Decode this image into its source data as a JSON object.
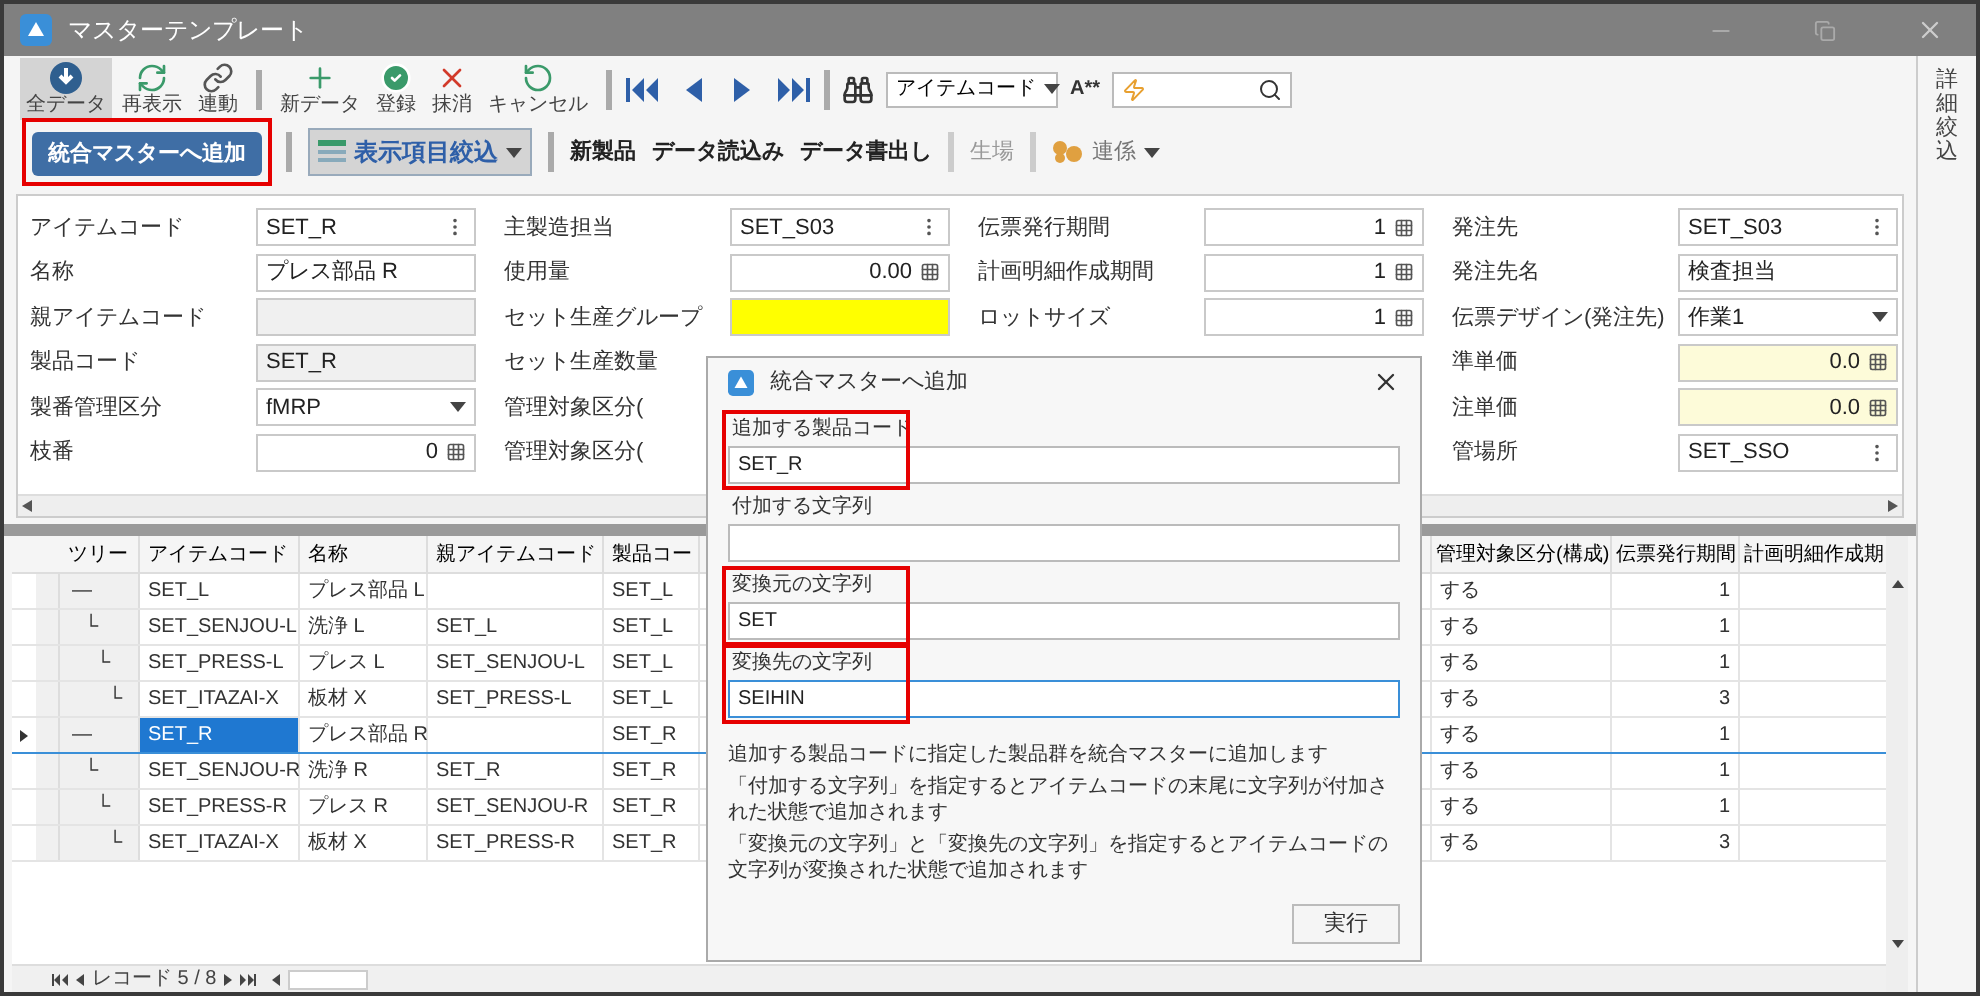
{
  "window": {
    "title": "マスターテンプレート"
  },
  "toolbar": {
    "buttons": [
      {
        "label": "全データ",
        "selected": true
      },
      {
        "label": "再表示",
        "selected": false
      },
      {
        "label": "連動",
        "selected": false
      },
      {
        "label": "新データ",
        "selected": false
      },
      {
        "label": "登録",
        "selected": false
      },
      {
        "label": "抹消",
        "selected": false
      },
      {
        "label": "キャンセル",
        "selected": false
      }
    ],
    "search_key": "アイテムコード",
    "font_size": "A**"
  },
  "action_bar": {
    "add_button": {
      "label": "統合マスターへ追加",
      "annotated": true
    },
    "filter_button": {
      "label": "表示項目絞込",
      "selected": true
    },
    "items": [
      {
        "label": "新製品",
        "disabled": false
      },
      {
        "label": "データ読込み",
        "disabled": false
      },
      {
        "label": "データ書出し",
        "disabled": false
      },
      {
        "label": "生場",
        "disabled": true
      }
    ],
    "link_menu": "連係"
  },
  "form": {
    "columns": [
      [
        {
          "label": "アイテムコード",
          "value": "SET_R",
          "kind": "menu"
        },
        {
          "label": "名称",
          "value": "プレス部品 R",
          "kind": "text"
        },
        {
          "label": "親アイテムコード",
          "kind": "disabled"
        },
        {
          "label": "製品コード",
          "value": "SET_R",
          "kind": "disabled"
        },
        {
          "label": "製番管理区分",
          "value": "fMRP",
          "kind": "select"
        },
        {
          "label": "枝番",
          "value": "0",
          "kind": "number"
        }
      ],
      [
        {
          "label": "主製造担当",
          "value": "SET_S03",
          "kind": "menu"
        },
        {
          "label": "使用量",
          "value": "0.00",
          "kind": "number"
        },
        {
          "label": "セット生産グループ",
          "kind": "required"
        },
        {
          "label": "セット生産数量",
          "kind": "covered"
        },
        {
          "label": "管理対象区分(",
          "kind": "covered"
        },
        {
          "label": "管理対象区分(",
          "kind": "covered"
        }
      ],
      [
        {
          "label": "伝票発行期間",
          "value": "1",
          "kind": "number"
        },
        {
          "label": "計画明細作成期間",
          "value": "1",
          "kind": "number"
        },
        {
          "label": "ロットサイズ",
          "value": "1",
          "kind": "number"
        }
      ],
      [
        {
          "label": "発注先",
          "value": "SET_S03",
          "kind": "menu"
        },
        {
          "label": "発注先名",
          "value": "検査担当",
          "kind": "text"
        },
        {
          "label": "伝票デザイン(発注先)",
          "value": "作業1",
          "kind": "select"
        },
        {
          "label": "準単価",
          "value": "0.0",
          "kind": "price"
        },
        {
          "label": "注単価",
          "value": "0.0",
          "kind": "price"
        },
        {
          "label": "管場所",
          "value": "SET_SSO",
          "kind": "menu"
        }
      ]
    ]
  },
  "table": {
    "columns": [
      "ツリー",
      "アイテムコード",
      "名称",
      "親アイテムコード",
      "製品コー",
      "管理対象区分(構成)",
      "伝票発行期間",
      "計画明細作成期"
    ],
    "rows": [
      {
        "cells": [
          "—",
          "SET_L",
          "プレス部品 L",
          "",
          "SET_L",
          "する",
          "1"
        ],
        "selected": false,
        "children": [
          {
            "cells": [
              "└",
              "SET_SENJOU-L",
              "洗浄 L",
              "SET_L",
              "SET_L",
              "する",
              "1"
            ],
            "selected": false,
            "children": [
              {
                "cells": [
                  "└",
                  "SET_PRESS-L",
                  "プレス L",
                  "SET_SENJOU-L",
                  "SET_L",
                  "する",
                  "1"
                ],
                "selected": false,
                "children": [
                  {
                    "cells": [
                      "└",
                      "SET_ITAZAI-X",
                      "板材 X",
                      "SET_PRESS-L",
                      "SET_L",
                      "する",
                      "3"
                    ],
                    "selected": false
                  }
                ]
              }
            ]
          }
        ]
      },
      {
        "cells": [
          "—",
          "SET_R",
          "プレス部品 R",
          "",
          "SET_R",
          "する",
          "1"
        ],
        "selected": true,
        "children": [
          {
            "cells": [
              "└",
              "SET_SENJOU-R",
              "洗浄 R",
              "SET_R",
              "SET_R",
              "する",
              "1"
            ],
            "selected": false,
            "children": [
              {
                "cells": [
                  "└",
                  "SET_PRESS-R",
                  "プレス R",
                  "SET_SENJOU-R",
                  "SET_R",
                  "する",
                  "1"
                ],
                "selected": false,
                "children": [
                  {
                    "cells": [
                      "└",
                      "SET_ITAZAI-X",
                      "板材 X",
                      "SET_PRESS-R",
                      "SET_R",
                      "する",
                      "3"
                    ],
                    "selected": false
                  }
                ]
              }
            ]
          }
        ]
      }
    ]
  },
  "pager": {
    "record": "レコード 5 / 8"
  },
  "dialog": {
    "title": "統合マスターへ追加",
    "fields": [
      {
        "label": "追加する製品コード",
        "value": "SET_R",
        "annotated": true,
        "focused": false
      },
      {
        "label": "付加する文字列",
        "annotated": false,
        "focused": false
      },
      {
        "label": "変換元の文字列",
        "value": "SET",
        "annotated": true,
        "focused": false
      },
      {
        "label": "変換先の文字列",
        "value": "SEIHIN",
        "annotated": true,
        "focused": true
      }
    ],
    "notes": [
      "追加する製品コードに指定した製品群を統合マスターに追加します",
      "「付加する文字列」を指定するとアイテムコードの末尾に文字列が付加された状態で追加されます",
      "「変換元の文字列」と「変換先の文字列」を指定するとアイテムコードの文字列が変換された状態で追加されます"
    ],
    "run_button": "実行"
  },
  "side_panel": {
    "title": "詳細絞込"
  }
}
